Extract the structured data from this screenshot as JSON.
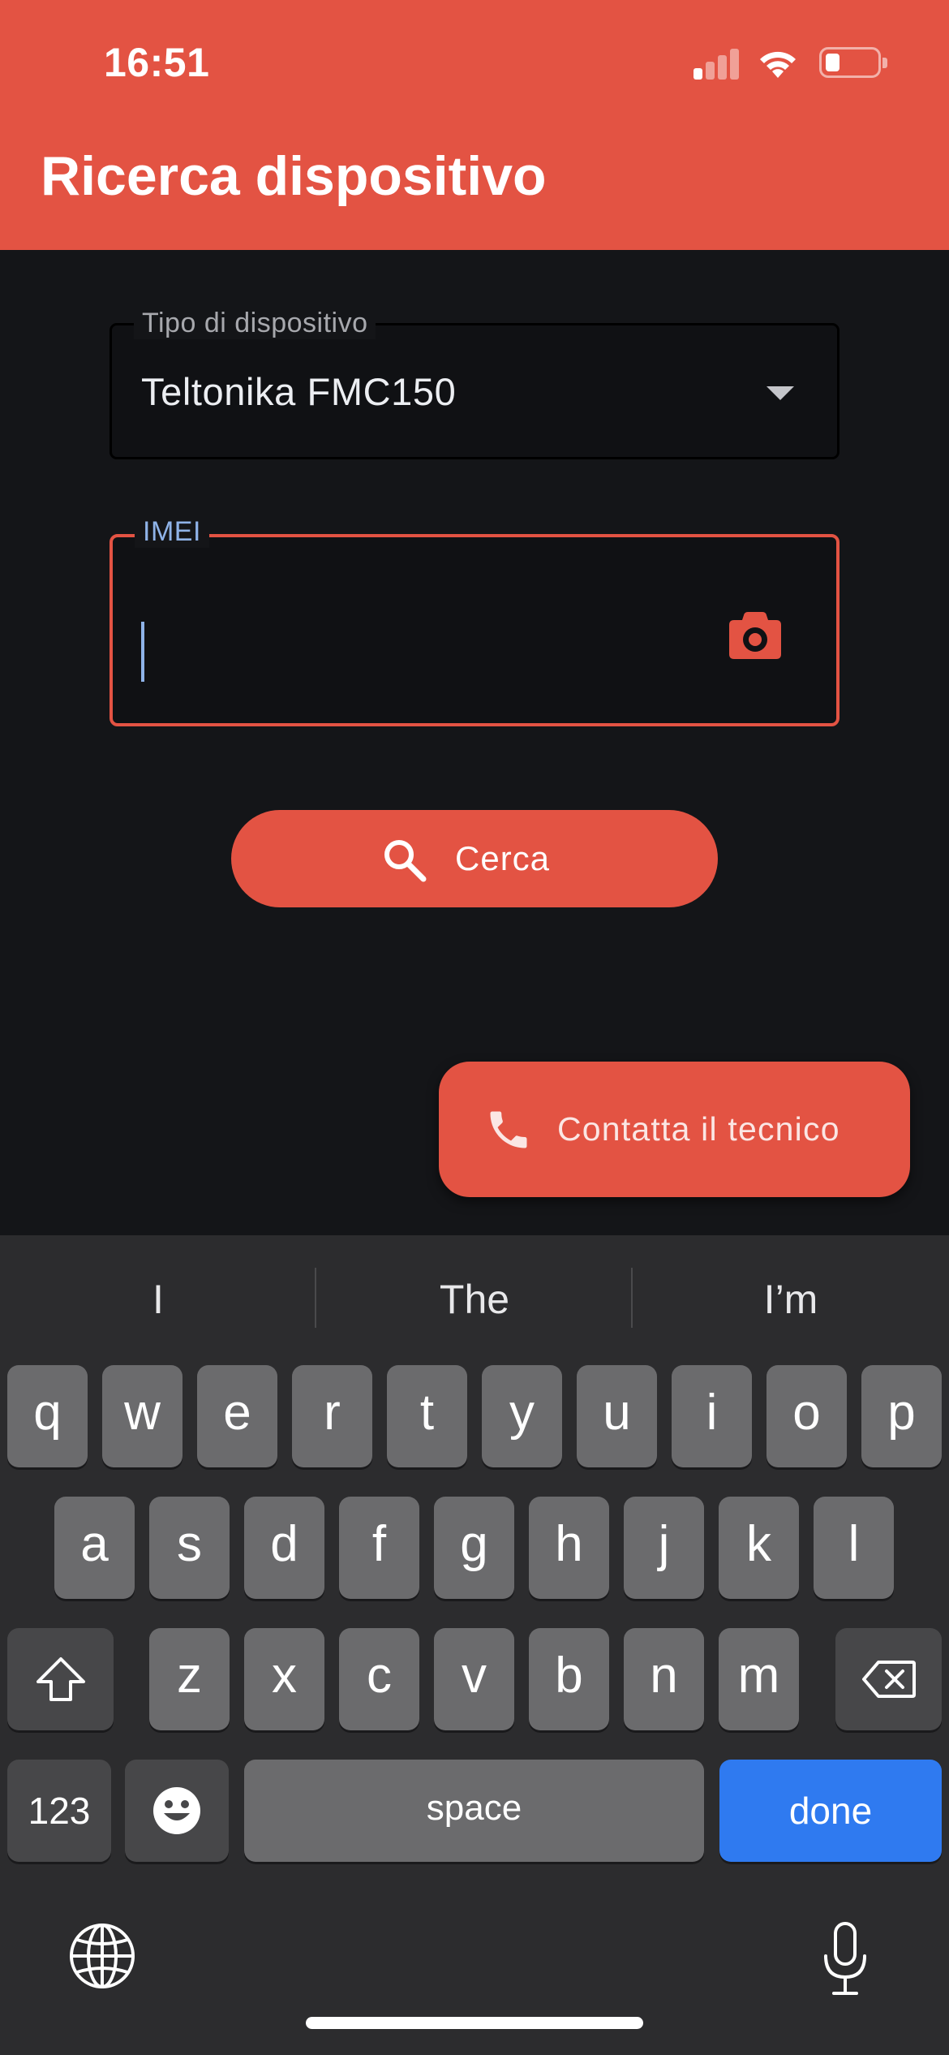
{
  "status_bar": {
    "time": "16:51",
    "signal_icon": "cellular-signal-icon",
    "wifi_icon": "wifi-icon",
    "battery_icon": "battery-icon",
    "battery_level": 0.25
  },
  "app_bar": {
    "title": "Ricerca dispositivo",
    "color": "#e35343"
  },
  "form": {
    "device_type": {
      "label": "Tipo di dispositivo",
      "value": "Teltonika FMC150"
    },
    "imei": {
      "label": "IMEI",
      "value": "",
      "camera_icon": "camera-icon"
    },
    "search_button": {
      "label": "Cerca",
      "icon": "search-icon"
    }
  },
  "fab": {
    "label": "Contatta il tecnico",
    "icon": "phone-icon"
  },
  "keyboard": {
    "suggestions": [
      "I",
      "The",
      "I’m"
    ],
    "row1": [
      "q",
      "w",
      "e",
      "r",
      "t",
      "y",
      "u",
      "i",
      "o",
      "p"
    ],
    "row2": [
      "a",
      "s",
      "d",
      "f",
      "g",
      "h",
      "j",
      "k",
      "l"
    ],
    "row3": [
      "z",
      "x",
      "c",
      "v",
      "b",
      "n",
      "m"
    ],
    "numbers_key": "123",
    "space_key": "space",
    "done_key": "done",
    "done_color": "#2f7af0"
  }
}
